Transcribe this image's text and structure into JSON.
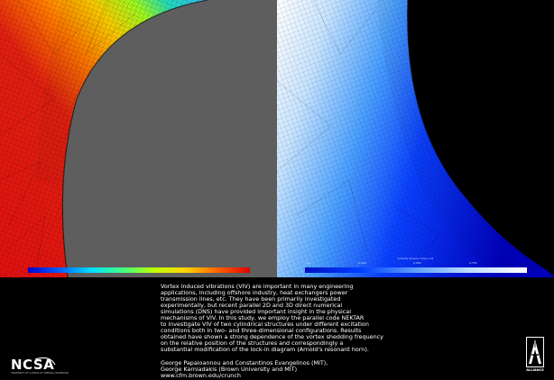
{
  "visualization": {
    "left_panel": {
      "description": "cylinder mesh colored by field (rainbow scale)",
      "cylinder_color": "#5e5e5e"
    },
    "right_panel": {
      "description": "cylinder mesh colored by field (blue-white scale)",
      "cylinder_color": "#000000"
    }
  },
  "colorbars": {
    "left": {
      "colors": [
        "#0000d0",
        "#00e0ff",
        "#c0ff00",
        "#e00000"
      ]
    },
    "right": {
      "title": "vorticity (Z-axis comp.) rot",
      "ticks": [
        "-0.8",
        "-0.400",
        "0.000",
        "0.750"
      ],
      "colors": [
        "#0010c0",
        "#0040ff",
        "#ffffff"
      ]
    }
  },
  "description": {
    "paragraph": "Vortex induced vibrations (VIV) are important in many engineering\napplications, including offshore industry, heat exchangers power\ntransmission lines, etc.  They have been primarily investigated\nexperimentally, but recent parallel 2D and 3D direct numerical\nsimulations (DNS) have provided important insight in the physical\nmechanisms of VIV.  In this study, we employ the parallel code NEKTAR\nto investigate VIV of two cylindrical structures under different excitation\nconditions both in two- and three-dimensional configurations.  Results\nobtained have shown a strong dependence of the vortex shedding frequency\non the relative position of the structures and correspondingly a\nsubstantial modification of the lock-in diagram (Arnold's resonant horn).",
    "authors": "George Papaioannou and Constantinos Evangelinos (MIT),\nGeorge Karniadakis (Brown University and MIT)\n          www.cfm.brown.edu/crunch"
  },
  "logos": {
    "ncsa": {
      "word": "NCSA",
      "subtitle": "UNIVERSITY OF ILLINOIS AT URBANA-CHAMPAIGN"
    },
    "alliance": {
      "tag": "ALLIANCE"
    }
  }
}
